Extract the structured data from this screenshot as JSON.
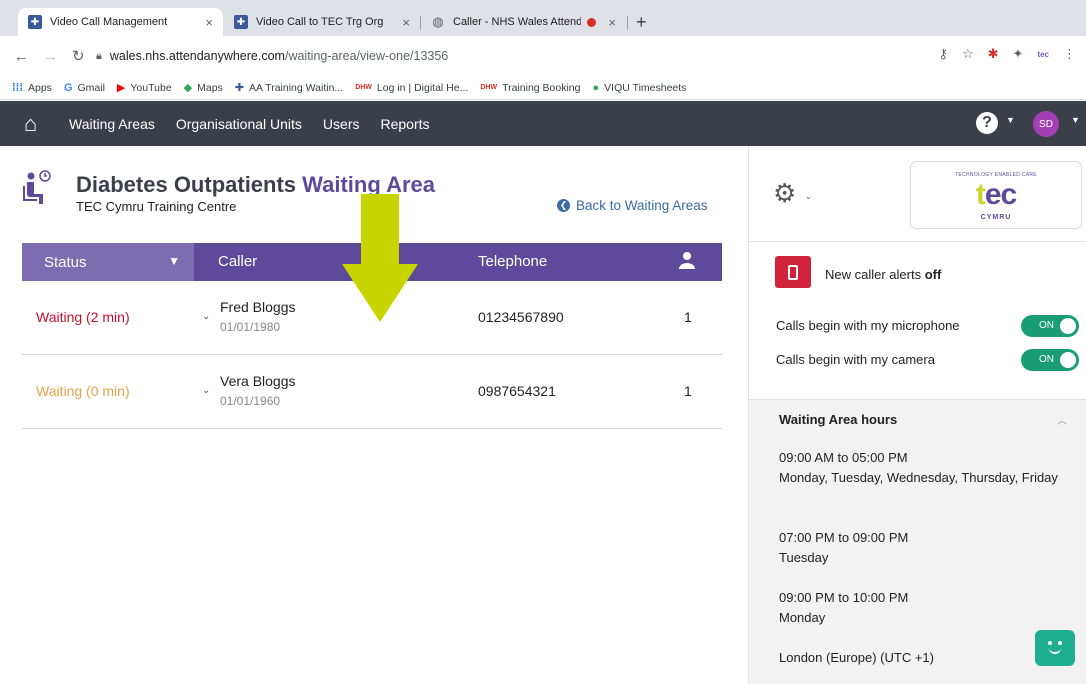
{
  "browser": {
    "tabs": [
      {
        "title": "Video Call Management",
        "close": "×",
        "favicon": "aa-favicon-icon"
      },
      {
        "title": "Video Call to TEC Trg Org",
        "close": "×",
        "favicon": "aa-favicon-icon"
      },
      {
        "title": "Caller - NHS Wales Attend",
        "close": "×",
        "favicon": "globe-icon"
      }
    ],
    "new_tab": "+",
    "url_host": "wales.nhs.attendanywhere.com",
    "url_path": "/waiting-area/view-one/13356",
    "bookmarks": [
      {
        "label": "Apps",
        "icon": "apps-grid-icon"
      },
      {
        "label": "Gmail",
        "icon": "google-icon"
      },
      {
        "label": "YouTube",
        "icon": "youtube-icon"
      },
      {
        "label": "Maps",
        "icon": "maps-icon"
      },
      {
        "label": "AA Training Waitin...",
        "icon": "aa-favicon-icon"
      },
      {
        "label": "Log in | Digital He...",
        "icon": "dhcw-icon"
      },
      {
        "label": "Training Booking",
        "icon": "dhcw-icon"
      },
      {
        "label": "VIQU Timesheets",
        "icon": "viqu-icon"
      }
    ]
  },
  "nav": {
    "items": [
      "Waiting Areas",
      "Organisational Units",
      "Users",
      "Reports"
    ],
    "help": "?",
    "avatar": "SD"
  },
  "waiting_area": {
    "title_main": "Diabetes Outpatients",
    "title_accent": "Waiting Area",
    "subtitle": "TEC Cymru Training Centre",
    "back_link": "Back to Waiting Areas"
  },
  "table": {
    "headers": {
      "status": "Status",
      "caller": "Caller",
      "telephone": "Telephone"
    },
    "rows": [
      {
        "status": "Waiting (2 min)",
        "name": "Fred Bloggs",
        "dob": "01/01/1980",
        "telephone": "01234567890",
        "count": "1",
        "status_color": "#c8102e"
      },
      {
        "status": "Waiting (0 min)",
        "name": "Vera Bloggs",
        "dob": "01/01/1960",
        "telephone": "0987654321",
        "count": "1",
        "status_color": "#e8a04c"
      }
    ]
  },
  "side": {
    "logo": {
      "tagline": "TECHNOLOGY ENABLED CARE",
      "word_t": "t",
      "word_rest": "ec",
      "sub": "CYMRU"
    },
    "alerts": {
      "prefix": "New caller alerts ",
      "state": "off"
    },
    "mic": {
      "label": "Calls begin with my microphone",
      "state": "ON"
    },
    "camera": {
      "label": "Calls begin with my camera",
      "state": "ON"
    },
    "hours": {
      "title": "Waiting Area hours",
      "blocks": [
        {
          "time": "09:00 AM to 05:00 PM",
          "days": "Monday, Tuesday, Wednesday, Thursday, Friday"
        },
        {
          "time": "07:00 PM to 09:00 PM",
          "days": "Tuesday"
        },
        {
          "time": "09:00 PM to 10:00 PM",
          "days": "Monday"
        }
      ],
      "timezone": "London (Europe) (UTC +1)"
    }
  },
  "colors": {
    "brand_purple": "#5d4a9b",
    "nav_bg": "#3b3f4a",
    "toggle_green": "#1a9d74",
    "alert_red": "#d0223b",
    "arrow_yellow": "#c8d400"
  }
}
